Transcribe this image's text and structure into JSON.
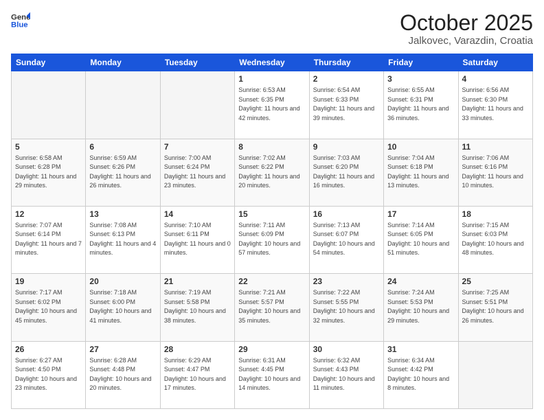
{
  "header": {
    "logo_general": "General",
    "logo_blue": "Blue",
    "month": "October 2025",
    "location": "Jalkovec, Varazdin, Croatia"
  },
  "weekdays": [
    "Sunday",
    "Monday",
    "Tuesday",
    "Wednesday",
    "Thursday",
    "Friday",
    "Saturday"
  ],
  "weeks": [
    [
      {
        "day": null
      },
      {
        "day": null
      },
      {
        "day": null
      },
      {
        "day": 1,
        "sunrise": "6:53 AM",
        "sunset": "6:35 PM",
        "daylight": "11 hours and 42 minutes."
      },
      {
        "day": 2,
        "sunrise": "6:54 AM",
        "sunset": "6:33 PM",
        "daylight": "11 hours and 39 minutes."
      },
      {
        "day": 3,
        "sunrise": "6:55 AM",
        "sunset": "6:31 PM",
        "daylight": "11 hours and 36 minutes."
      },
      {
        "day": 4,
        "sunrise": "6:56 AM",
        "sunset": "6:30 PM",
        "daylight": "11 hours and 33 minutes."
      }
    ],
    [
      {
        "day": 5,
        "sunrise": "6:58 AM",
        "sunset": "6:28 PM",
        "daylight": "11 hours and 29 minutes."
      },
      {
        "day": 6,
        "sunrise": "6:59 AM",
        "sunset": "6:26 PM",
        "daylight": "11 hours and 26 minutes."
      },
      {
        "day": 7,
        "sunrise": "7:00 AM",
        "sunset": "6:24 PM",
        "daylight": "11 hours and 23 minutes."
      },
      {
        "day": 8,
        "sunrise": "7:02 AM",
        "sunset": "6:22 PM",
        "daylight": "11 hours and 20 minutes."
      },
      {
        "day": 9,
        "sunrise": "7:03 AM",
        "sunset": "6:20 PM",
        "daylight": "11 hours and 16 minutes."
      },
      {
        "day": 10,
        "sunrise": "7:04 AM",
        "sunset": "6:18 PM",
        "daylight": "11 hours and 13 minutes."
      },
      {
        "day": 11,
        "sunrise": "7:06 AM",
        "sunset": "6:16 PM",
        "daylight": "11 hours and 10 minutes."
      }
    ],
    [
      {
        "day": 12,
        "sunrise": "7:07 AM",
        "sunset": "6:14 PM",
        "daylight": "11 hours and 7 minutes."
      },
      {
        "day": 13,
        "sunrise": "7:08 AM",
        "sunset": "6:13 PM",
        "daylight": "11 hours and 4 minutes."
      },
      {
        "day": 14,
        "sunrise": "7:10 AM",
        "sunset": "6:11 PM",
        "daylight": "11 hours and 0 minutes."
      },
      {
        "day": 15,
        "sunrise": "7:11 AM",
        "sunset": "6:09 PM",
        "daylight": "10 hours and 57 minutes."
      },
      {
        "day": 16,
        "sunrise": "7:13 AM",
        "sunset": "6:07 PM",
        "daylight": "10 hours and 54 minutes."
      },
      {
        "day": 17,
        "sunrise": "7:14 AM",
        "sunset": "6:05 PM",
        "daylight": "10 hours and 51 minutes."
      },
      {
        "day": 18,
        "sunrise": "7:15 AM",
        "sunset": "6:03 PM",
        "daylight": "10 hours and 48 minutes."
      }
    ],
    [
      {
        "day": 19,
        "sunrise": "7:17 AM",
        "sunset": "6:02 PM",
        "daylight": "10 hours and 45 minutes."
      },
      {
        "day": 20,
        "sunrise": "7:18 AM",
        "sunset": "6:00 PM",
        "daylight": "10 hours and 41 minutes."
      },
      {
        "day": 21,
        "sunrise": "7:19 AM",
        "sunset": "5:58 PM",
        "daylight": "10 hours and 38 minutes."
      },
      {
        "day": 22,
        "sunrise": "7:21 AM",
        "sunset": "5:57 PM",
        "daylight": "10 hours and 35 minutes."
      },
      {
        "day": 23,
        "sunrise": "7:22 AM",
        "sunset": "5:55 PM",
        "daylight": "10 hours and 32 minutes."
      },
      {
        "day": 24,
        "sunrise": "7:24 AM",
        "sunset": "5:53 PM",
        "daylight": "10 hours and 29 minutes."
      },
      {
        "day": 25,
        "sunrise": "7:25 AM",
        "sunset": "5:51 PM",
        "daylight": "10 hours and 26 minutes."
      }
    ],
    [
      {
        "day": 26,
        "sunrise": "6:27 AM",
        "sunset": "4:50 PM",
        "daylight": "10 hours and 23 minutes."
      },
      {
        "day": 27,
        "sunrise": "6:28 AM",
        "sunset": "4:48 PM",
        "daylight": "10 hours and 20 minutes."
      },
      {
        "day": 28,
        "sunrise": "6:29 AM",
        "sunset": "4:47 PM",
        "daylight": "10 hours and 17 minutes."
      },
      {
        "day": 29,
        "sunrise": "6:31 AM",
        "sunset": "4:45 PM",
        "daylight": "10 hours and 14 minutes."
      },
      {
        "day": 30,
        "sunrise": "6:32 AM",
        "sunset": "4:43 PM",
        "daylight": "10 hours and 11 minutes."
      },
      {
        "day": 31,
        "sunrise": "6:34 AM",
        "sunset": "4:42 PM",
        "daylight": "10 hours and 8 minutes."
      },
      {
        "day": null
      }
    ]
  ],
  "labels": {
    "sunrise": "Sunrise:",
    "sunset": "Sunset:",
    "daylight": "Daylight:"
  }
}
